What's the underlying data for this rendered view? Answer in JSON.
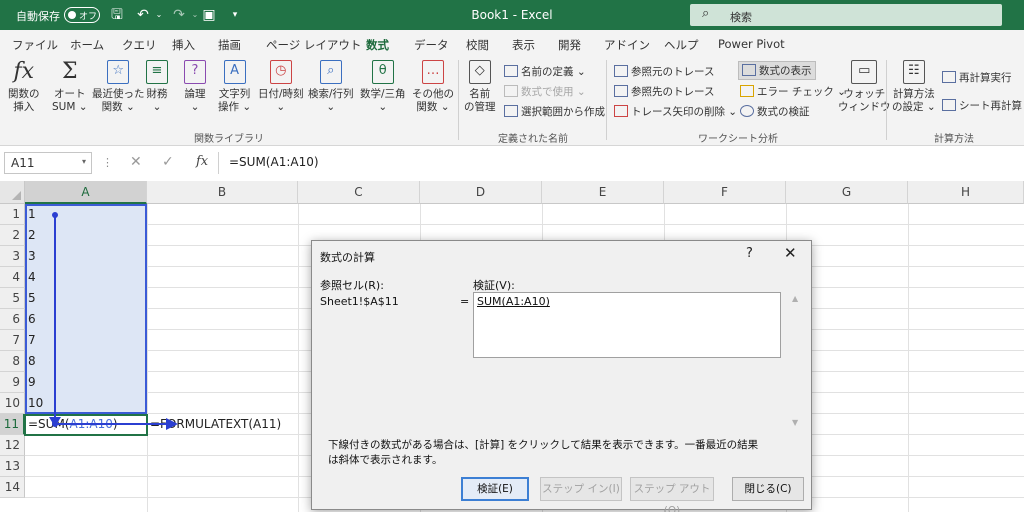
{
  "titlebar": {
    "autosave_label": "自動保存",
    "autosave_state": "オフ",
    "document_title": "Book1  -  Excel",
    "search_placeholder": "検索"
  },
  "tabs": [
    "ファイル",
    "ホーム",
    "クエリ",
    "挿入",
    "描画",
    "ページ レイアウト",
    "数式",
    "データ",
    "校閲",
    "表示",
    "開発",
    "アドイン",
    "ヘルプ",
    "Power Pivot"
  ],
  "active_tab": "数式",
  "ribbon": {
    "function_library": {
      "insert_function": [
        "関数の",
        "挿入"
      ],
      "autosum": [
        "オート",
        "SUM ⌄"
      ],
      "recent": [
        "最近使った",
        "関数 ⌄"
      ],
      "financial": [
        "財務",
        "⌄"
      ],
      "logical": [
        "論理",
        "⌄"
      ],
      "text": [
        "文字列",
        "操作 ⌄"
      ],
      "datetime": [
        "日付/時刻",
        "⌄"
      ],
      "lookup": [
        "検索/行列",
        "⌄"
      ],
      "math": [
        "数学/三角",
        "⌄"
      ],
      "more": [
        "その他の",
        "関数 ⌄"
      ],
      "group_label": "関数ライブラリ"
    },
    "defined_names": {
      "name_manager": [
        "名前",
        "の管理"
      ],
      "define_name": "名前の定義 ⌄",
      "use_in_formula": "数式で使用 ⌄",
      "create_from_selection": "選択範囲から作成",
      "group_label": "定義された名前"
    },
    "formula_auditing": {
      "trace_precedents": "参照元のトレース",
      "trace_dependents": "参照先のトレース",
      "remove_arrows": "トレース矢印の削除 ⌄",
      "show_formulas": "数式の表示",
      "error_checking": "エラー チェック ⌄",
      "evaluate_formula": "数式の検証",
      "watch_window": [
        "ウォッチ",
        "ウィンドウ"
      ],
      "group_label": "ワークシート分析"
    },
    "calculation": {
      "calc_options": [
        "計算方法",
        "の設定 ⌄"
      ],
      "calc_now": "再計算実行",
      "calc_sheet": "シート再計算",
      "group_label": "計算方法"
    }
  },
  "formula_bar": {
    "name_box": "A11",
    "fx": "fx",
    "formula": "=SUM(A1:A10)"
  },
  "grid": {
    "columns": [
      "A",
      "B",
      "C",
      "D",
      "E",
      "F",
      "G",
      "H"
    ],
    "rows": [
      "1",
      "2",
      "3",
      "4",
      "5",
      "6",
      "7",
      "8",
      "9",
      "10",
      "11",
      "12",
      "13",
      "14"
    ],
    "a_values": [
      "1",
      "2",
      "3",
      "4",
      "5",
      "6",
      "7",
      "8",
      "9",
      "10"
    ],
    "a11_prefix": "=SUM(",
    "a11_ref": "A1:A10",
    "a11_suffix": ")",
    "b11": "=FORMULATEXT(A11)"
  },
  "dialog": {
    "title": "数式の計算",
    "help": "?",
    "close": "✕",
    "reference_label": "参照セル(R):",
    "reference_value": "Sheet1!$A$11",
    "evaluation_label": "検証(V):",
    "equals": "=",
    "evaluation_value": "SUM(A1:A10)",
    "note": "下線付きの数式がある場合は、[計算] をクリックして結果を表示できます。一番最近の結果は斜体で表示されます。",
    "buttons": {
      "evaluate": "検証(E)",
      "step_in": "ステップ イン(I)",
      "step_out": "ステップ アウト(O)",
      "close": "閉じる(C)"
    }
  }
}
